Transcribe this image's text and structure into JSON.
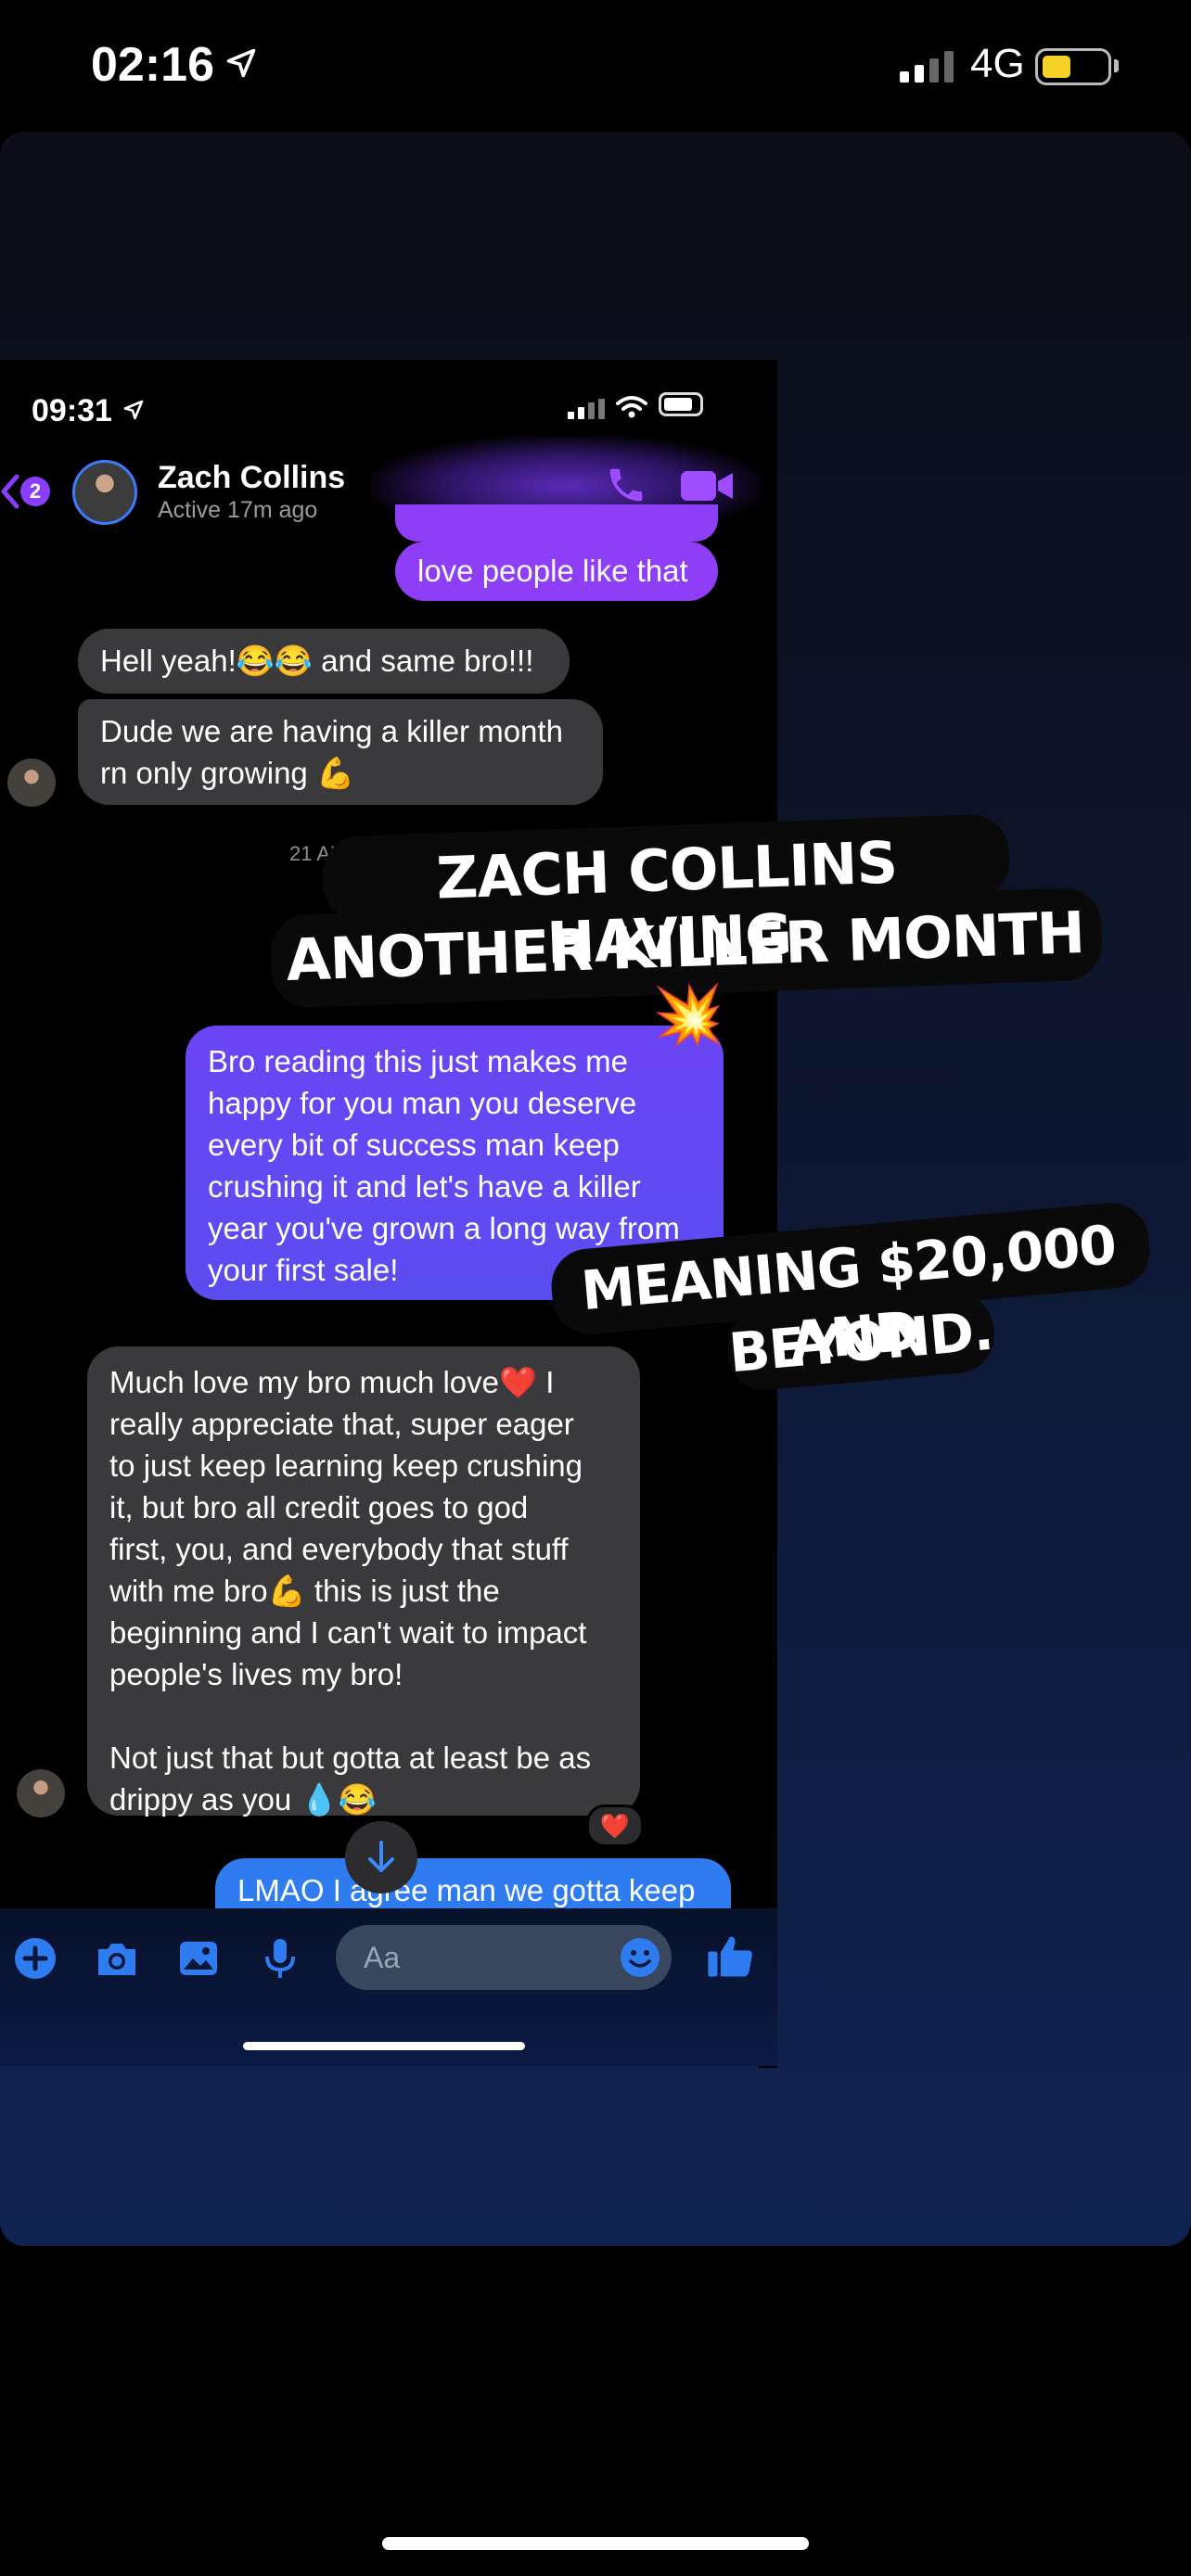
{
  "status_bar": {
    "time": "02:16",
    "network": "4G"
  },
  "inner_status_bar": {
    "time": "09:31"
  },
  "chat_header": {
    "back_badge": "2",
    "contact_name": "Zach Collins",
    "contact_status": "Active 17m ago"
  },
  "messages": [
    {
      "text": "love people like that"
    },
    {
      "text": "Hell yeah!😂😂 and same bro!!!"
    },
    {
      "text": "Dude we are having a killer month\nrn only growing 💪"
    },
    {
      "text": "Bro reading this just makes me\nhappy for you man you deserve\nevery bit of success man keep\ncrushing it and let's have a killer\nyear you've grown a long way from\nyour first sale!"
    },
    {
      "text": "Much love my bro much love❤️ I\nreally appreciate that, super eager\nto just keep learning keep crushing\nit, but bro all credit goes to god\nfirst, you, and everybody that stuff\nwith me bro💪 this is just the\nbeginning and I can't wait to impact\npeople's lives my bro!\n\nNot just that but gotta at least be as\ndrippy as you 💧😂"
    },
    {
      "text": "LMAO I agree man we gotta keep"
    }
  ],
  "date_separator": "21 AU",
  "reaction": "❤️",
  "captions": {
    "headline_line1": "ZACH COLLINS HAVING",
    "headline_line2": "ANOTHER KILLER MONTH 💥",
    "sub_line1": "MEANING $20,000 AND",
    "sub_line2": "BEYOND."
  },
  "composer": {
    "placeholder": "Aa"
  },
  "colors": {
    "messenger_purple": "#8e3ef6",
    "messenger_blue": "#2f7cf0",
    "battery_yellow": "#f5d228"
  },
  "icons": [
    "location-arrow-icon",
    "signal-icon",
    "battery-icon",
    "wifi-icon",
    "chevron-left-icon",
    "phone-icon",
    "video-camera-icon",
    "arrow-down-icon",
    "plus-icon",
    "camera-icon",
    "image-icon",
    "microphone-icon",
    "emoji-icon",
    "thumbs-up-icon"
  ]
}
